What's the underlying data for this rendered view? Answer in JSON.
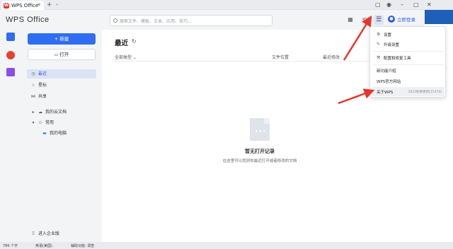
{
  "tab": {
    "label": "WPS Office",
    "logo": "W"
  },
  "header": {
    "app_title": "WPS Office",
    "search_placeholder": "搜索文件、模板、文本、应用、技巧...",
    "login_label": "立即登录"
  },
  "sidebar": {
    "new_label": "+ 新建",
    "open_label": "打开",
    "items": [
      {
        "label": "最近",
        "icon": "clock-icon"
      },
      {
        "label": "星标",
        "icon": "star-icon"
      },
      {
        "label": "共享",
        "icon": "share-icon"
      },
      {
        "label": "我的云文档",
        "icon": "cloud-icon"
      },
      {
        "label": "常用",
        "icon": "star-outline-icon"
      },
      {
        "label": "我的电脑",
        "icon": "computer-icon"
      }
    ],
    "enterprise_label": "进入企业版"
  },
  "main": {
    "title": "最近",
    "columns": [
      "全部类型",
      "文件位置",
      "最近修改"
    ],
    "empty_title": "暂无打开记录",
    "empty_subtitle": "在这里可以找到你最近打开或者修改的文档"
  },
  "menu": {
    "items": [
      {
        "label": "设置",
        "icon": "gear-icon"
      },
      {
        "label": "升级设置",
        "icon": "wrench-icon"
      },
      {
        "label": "配置和修复工具",
        "icon": "repair-icon"
      },
      {
        "label": "新功能介绍",
        "icon": ""
      },
      {
        "label": "WPS官方网站",
        "icon": ""
      },
      {
        "label": "关于WPS",
        "icon": "",
        "version": "2023秋季更新(15374)"
      }
    ]
  },
  "status": {
    "words": "786 个字",
    "lang": "英语(美国)",
    "a11y": "辅助功能: 调查"
  },
  "colors": {
    "accent": "#2f6ef0",
    "arrow": "#e8352b"
  }
}
